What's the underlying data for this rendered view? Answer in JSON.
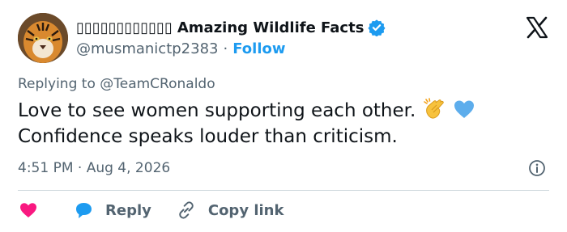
{
  "author": {
    "name_prefix": "▯▯▯▯▯▯▯▯▯▯▯▯",
    "display_name": "Amazing Wildlife Facts",
    "handle": "@musmanictp2383",
    "separator": "·",
    "follow_label": "Follow",
    "avatar_icon": "tiger-avatar",
    "verified": true
  },
  "reply_to": "Replying to @TeamCRonaldo",
  "body": {
    "line1": "Love to see women supporting each other.",
    "line2": "Confidence speaks louder than criticism.",
    "emojis": [
      "clapping-hands-icon",
      "blue-heart-icon"
    ]
  },
  "meta": {
    "timestamp": "4:51 PM · Aug 4, 2026"
  },
  "actions": {
    "like_icon": "heart-icon",
    "reply_label": "Reply",
    "copy_link_label": "Copy link"
  },
  "colors": {
    "accent": "#1d9bf0",
    "like": "#f91880",
    "text": "#0f1419",
    "secondary": "#536471",
    "divider": "#cfd9de"
  }
}
